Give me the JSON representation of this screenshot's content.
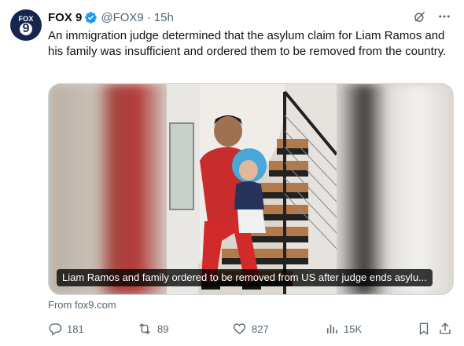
{
  "account": {
    "avatar_text_top": "FOX",
    "avatar_text_bottom": "9",
    "display_name": "FOX 9",
    "handle": "@FOX9",
    "separator": "·",
    "time": "15h"
  },
  "tweet": {
    "text": "An immigration judge determined that the asylum claim for Liam Ramos and his family was insufficient and ordered them to be removed from the country."
  },
  "card": {
    "caption": "Liam Ramos and family ordered to be removed from US after judge ends asylu...",
    "source": "From fox9.com"
  },
  "actions": {
    "replies": "181",
    "reposts": "89",
    "likes": "827",
    "views": "15K"
  },
  "icons": {
    "verified": "verified-badge-icon",
    "grok": "grok-icon",
    "more": "more-icon",
    "reply": "reply-icon",
    "repost": "repost-icon",
    "like": "like-icon",
    "views": "views-icon",
    "bookmark": "bookmark-icon",
    "share": "share-icon"
  },
  "colors": {
    "text": "#0f1419",
    "secondary": "#536471",
    "verified": "#1d9bf0",
    "avatar_bg": "#15254d"
  }
}
